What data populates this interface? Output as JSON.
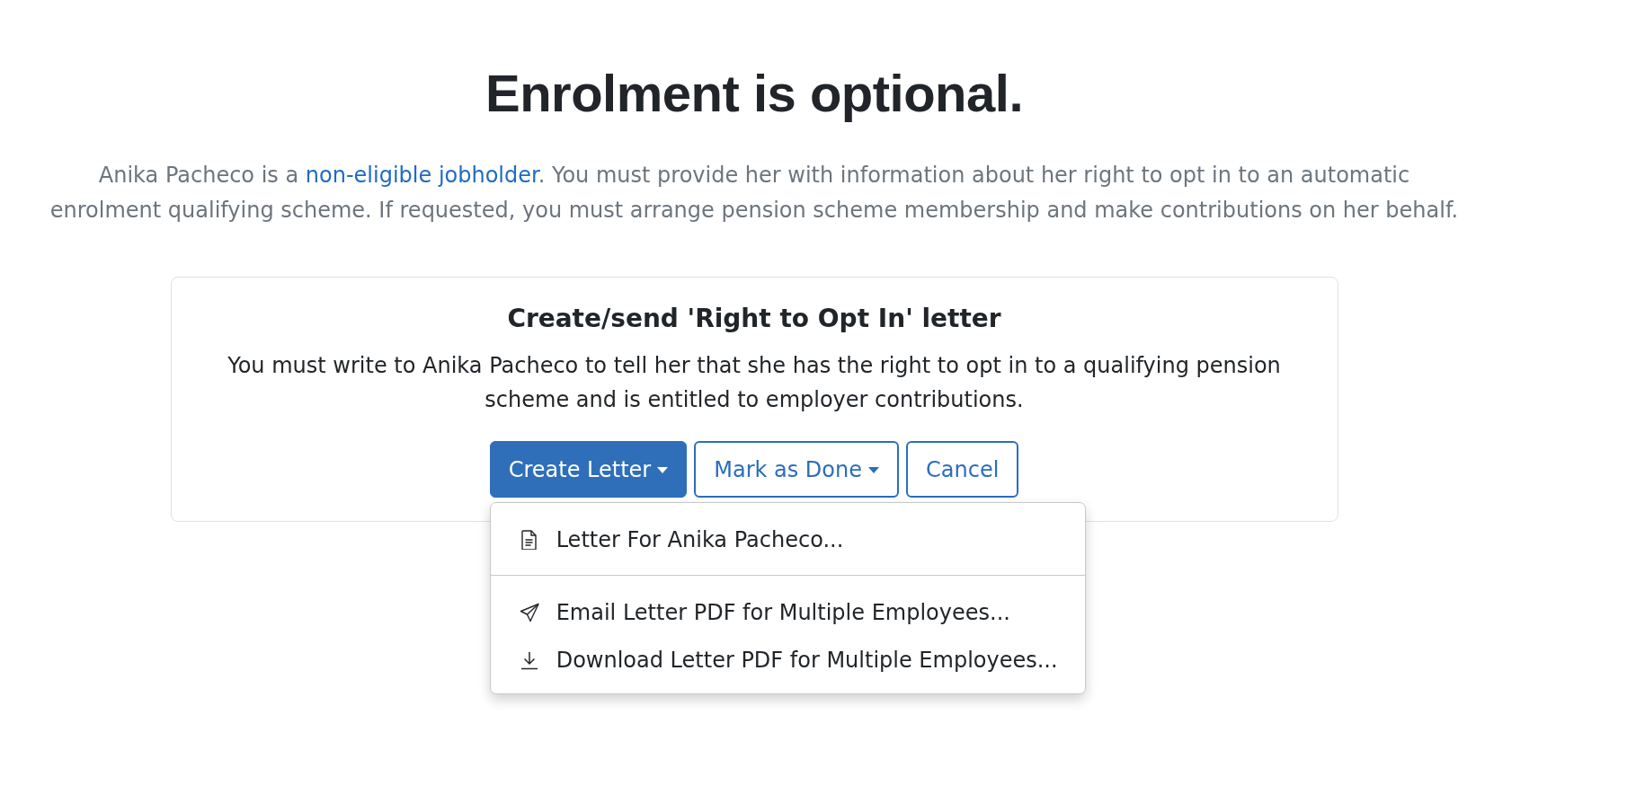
{
  "heading": "Enrolment is optional.",
  "intro": {
    "before": "Anika Pacheco is a ",
    "link": "non-eligible jobholder",
    "after": ". You must provide her with information about her right to opt in to an automatic enrolment qualifying scheme. If requested, you must arrange pension scheme membership and make contributions on her behalf."
  },
  "card": {
    "title": "Create/send 'Right to Opt In' letter",
    "body": "You must write to Anika Pacheco to tell her that she has the right to opt in to a qualifying pension scheme and is entitled to employer contributions.",
    "buttons": [
      {
        "label": "Create Letter",
        "kind": "primary",
        "caret": true,
        "menu": [
          [
            {
              "label": "Letter For Anika Pacheco...",
              "kind": "letter"
            }
          ],
          [
            {
              "label": "Email Letter PDF for Multiple Employees...",
              "kind": "email"
            },
            {
              "label": "Download Letter PDF for Multiple Employees...",
              "kind": "download"
            }
          ]
        ]
      },
      {
        "label": "Mark as Done",
        "kind": "outline",
        "caret": true
      },
      {
        "label": "Cancel",
        "kind": "outline",
        "caret": false
      }
    ]
  }
}
